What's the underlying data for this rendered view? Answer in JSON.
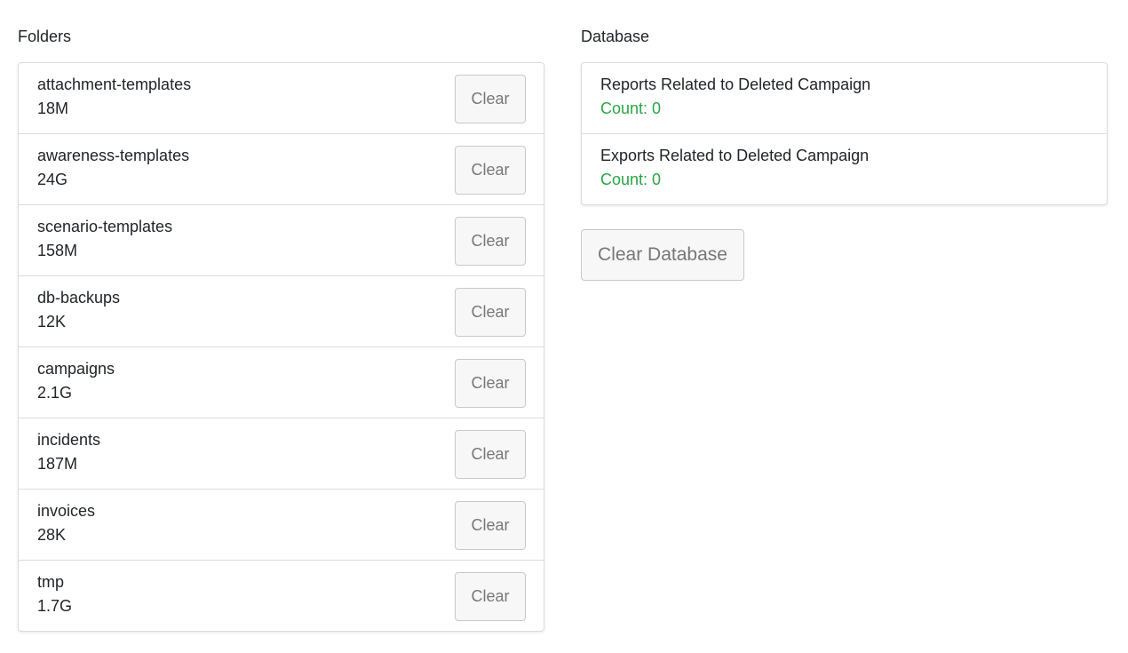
{
  "folders": {
    "title": "Folders",
    "clear_label": "Clear",
    "items": [
      {
        "name": "attachment-templates",
        "size": "18M"
      },
      {
        "name": "awareness-templates",
        "size": "24G"
      },
      {
        "name": "scenario-templates",
        "size": "158M"
      },
      {
        "name": "db-backups",
        "size": "12K"
      },
      {
        "name": "campaigns",
        "size": "2.1G"
      },
      {
        "name": "incidents",
        "size": "187M"
      },
      {
        "name": "invoices",
        "size": "28K"
      },
      {
        "name": "tmp",
        "size": "1.7G"
      }
    ]
  },
  "database": {
    "title": "Database",
    "items": [
      {
        "name": "Reports Related to Deleted Campaign",
        "count": "Count: 0"
      },
      {
        "name": "Exports Related to Deleted Campaign",
        "count": "Count: 0"
      }
    ],
    "clear_button_label": "Clear Database"
  },
  "colors": {
    "count_text": "#28a745",
    "border": "#dcdcdc",
    "button_bg": "#f7f7f7",
    "button_text": "#777777"
  }
}
